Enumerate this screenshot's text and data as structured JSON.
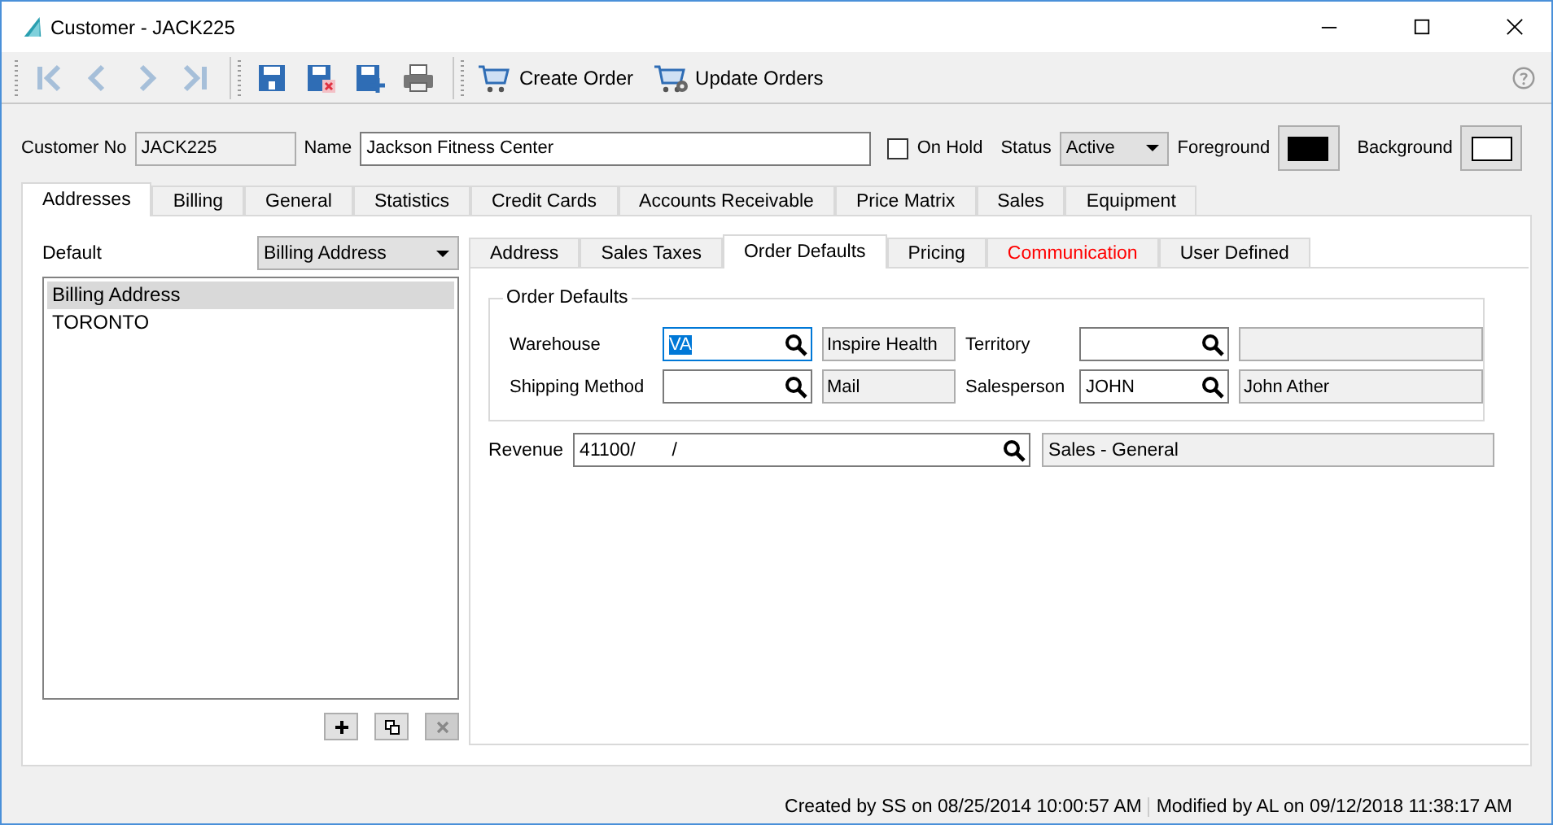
{
  "window": {
    "title": "Customer - JACK225"
  },
  "toolbar": {
    "nav": [
      {
        "kind": "first",
        "disabled": true
      },
      {
        "kind": "prev",
        "disabled": true
      },
      {
        "kind": "next",
        "disabled": true
      },
      {
        "kind": "last",
        "disabled": true
      }
    ],
    "actions": [
      {
        "kind": "cart",
        "label": "Create Order"
      },
      {
        "kind": "cart-gear",
        "label": "Update Orders"
      }
    ]
  },
  "header": {
    "customer_no": {
      "label": "Customer No",
      "value": "JACK225"
    },
    "name": {
      "label": "Name",
      "value": "Jackson Fitness Center"
    },
    "on_hold": {
      "label": "On Hold",
      "checked": false
    },
    "status": {
      "label": "Status",
      "value": "Active"
    },
    "foreground": {
      "label": "Foreground",
      "color": "#000000"
    },
    "background": {
      "label": "Background",
      "color": "#ffffff"
    }
  },
  "tabs": [
    {
      "label": "Addresses",
      "selected": true
    },
    {
      "label": "Billing",
      "selected": false
    },
    {
      "label": "General",
      "selected": false
    },
    {
      "label": "Statistics",
      "selected": false
    },
    {
      "label": "Credit Cards",
      "selected": false
    },
    {
      "label": "Accounts Receivable",
      "selected": false
    },
    {
      "label": "Price Matrix",
      "selected": false
    },
    {
      "label": "Sales",
      "selected": false
    },
    {
      "label": "Equipment",
      "selected": false
    }
  ],
  "addresses": {
    "default_label": "Default",
    "default_value": "Billing Address",
    "items": [
      {
        "label": "Billing Address",
        "selected": true
      },
      {
        "label": "TORONTO",
        "selected": false
      }
    ],
    "delete_disabled": true
  },
  "subtabs": [
    {
      "label": "Address",
      "selected": false,
      "flagged": false
    },
    {
      "label": "Sales Taxes",
      "selected": false,
      "flagged": false
    },
    {
      "label": "Order Defaults",
      "selected": true,
      "flagged": false
    },
    {
      "label": "Pricing",
      "selected": false,
      "flagged": false
    },
    {
      "label": "Communication",
      "selected": false,
      "flagged": true
    },
    {
      "label": "User Defined",
      "selected": false,
      "flagged": false
    }
  ],
  "order_defaults": {
    "title": "Order Defaults",
    "fields": [
      {
        "label": "Warehouse",
        "value": "VA",
        "description": "Inspire Health",
        "focused": true
      },
      {
        "label": "Territory",
        "focused": false
      },
      {
        "label": "Shipping Method",
        "description": "Mail",
        "focused": false
      },
      {
        "label": "Salesperson",
        "value": "JOHN",
        "description": "John Ather",
        "focused": false
      }
    ]
  },
  "revenue": {
    "label": "Revenue",
    "value": "41100/       /",
    "description": "Sales - General"
  },
  "status_bar": {
    "created": "Created by SS on 08/25/2014 10:00:57 AM",
    "modified": "Modified by AL on 09/12/2018 11:38:17 AM"
  }
}
